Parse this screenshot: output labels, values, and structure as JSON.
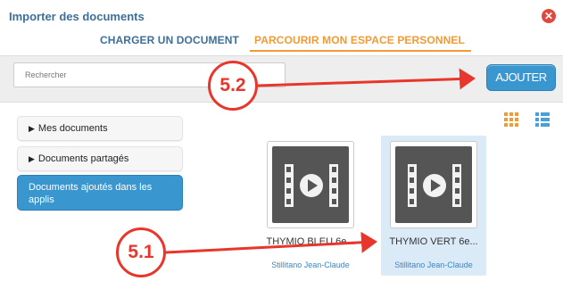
{
  "dialog": {
    "title": "Importer des documents",
    "close_symbol": "✕"
  },
  "tabs": [
    {
      "label": "CHARGER UN DOCUMENT",
      "active": false
    },
    {
      "label": "PARCOURIR MON ESPACE PERSONNEL",
      "active": true
    }
  ],
  "toolbar": {
    "search_placeholder": "Rechercher",
    "add_label": "AJOUTER"
  },
  "views": {
    "grid_icon": "grid-view-icon",
    "list_icon": "list-view-icon",
    "grid_color": "#f29a33",
    "list_color": "#4a9fd8"
  },
  "sidebar": {
    "items": [
      {
        "label": "Mes documents",
        "selected": false
      },
      {
        "label": "Documents partagés",
        "selected": false
      },
      {
        "label": "Documents ajoutés dans les applis",
        "selected": true
      }
    ]
  },
  "documents": [
    {
      "name": "THYMIO BLEU 6e...",
      "author": "Stillitano Jean-Claude",
      "selected": false,
      "icon": "video-file-icon"
    },
    {
      "name": "THYMIO VERT 6e...",
      "author": "Stillitano Jean-Claude",
      "selected": true,
      "icon": "video-file-icon"
    }
  ],
  "annotations": [
    {
      "label": "5.2"
    },
    {
      "label": "5.1"
    }
  ],
  "colors": {
    "accent_blue": "#3a96cf",
    "accent_orange": "#f29a33",
    "annotation_red": "#e8362c",
    "close_red": "#e2473e"
  }
}
